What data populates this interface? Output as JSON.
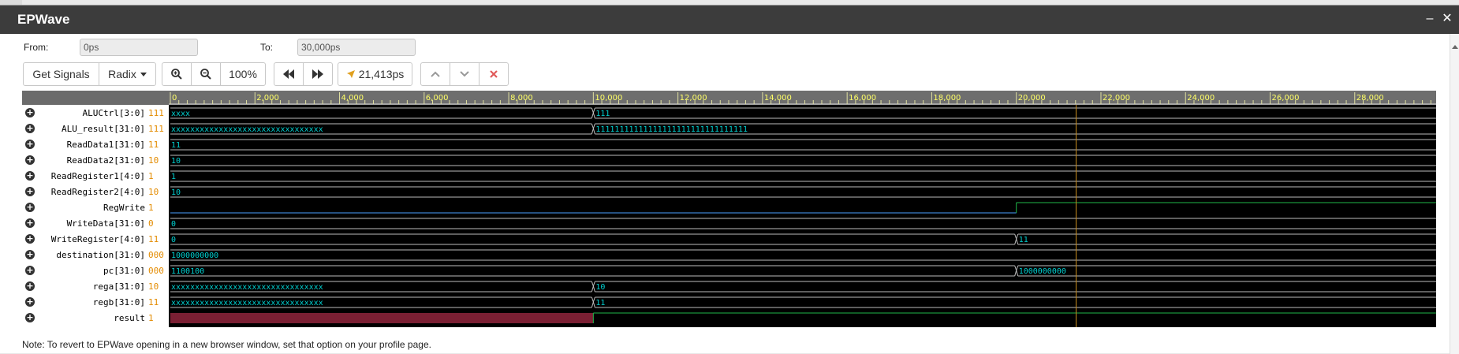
{
  "window": {
    "title": "EPWave",
    "minimize_glyph": "–",
    "close_glyph": "✕"
  },
  "range": {
    "from_label": "From:",
    "from_value": "0ps",
    "to_label": "To:",
    "to_value": "30,000ps"
  },
  "toolbar": {
    "get_signals": "Get Signals",
    "radix": "Radix",
    "zoom_in_icon": "zoom-in-icon",
    "zoom_out_icon": "zoom-out-icon",
    "zoom_level": "100%",
    "prev_edge_icon": "rewind-icon",
    "next_edge_icon": "fast-forward-icon",
    "cursor_time": "21,413ps",
    "cursor_icon": "cursor-arrow-icon",
    "up_icon": "chevron-up-icon",
    "down_icon": "chevron-down-icon",
    "delete_icon": "close-icon",
    "delete_color": "#e05a5a"
  },
  "timeline": {
    "start": 0,
    "end": 30000,
    "cursor": 21413,
    "tick_labels": [
      "0",
      "2,000",
      "4,000",
      "6,000",
      "8,000",
      "10,000",
      "12,000",
      "14,000",
      "16,000",
      "18,000",
      "20,000",
      "22,000",
      "24,000",
      "26,000",
      "28,000"
    ],
    "tick_values": [
      0,
      2000,
      4000,
      6000,
      8000,
      10000,
      12000,
      14000,
      16000,
      18000,
      20000,
      22000,
      24000,
      26000,
      28000
    ]
  },
  "colors": {
    "bus": "#00d0d0",
    "bit_high": "#1fb84a",
    "bit_low": "#4aa0ff",
    "cursor": "#c58a1c",
    "red_fill": "#7a1f33",
    "ruler_text": "#ffff66"
  },
  "signals": [
    {
      "name": "ALUCtrl[3:0]",
      "value": "111",
      "type": "bus",
      "segments": [
        {
          "start": 0,
          "label": "xxxx"
        },
        {
          "start": 10000,
          "label": "111"
        }
      ]
    },
    {
      "name": "ALU_result[31:0]",
      "value": "111",
      "type": "bus",
      "segments": [
        {
          "start": 0,
          "label": "xxxxxxxxxxxxxxxxxxxxxxxxxxxxxxxx"
        },
        {
          "start": 10000,
          "label": "11111111111111111111111111111111"
        }
      ]
    },
    {
      "name": "ReadData1[31:0]",
      "value": "11",
      "type": "bus",
      "segments": [
        {
          "start": 0,
          "label": "11"
        }
      ]
    },
    {
      "name": "ReadData2[31:0]",
      "value": "10",
      "type": "bus",
      "segments": [
        {
          "start": 0,
          "label": "10"
        }
      ]
    },
    {
      "name": "ReadRegister1[4:0]",
      "value": "1",
      "type": "bus",
      "segments": [
        {
          "start": 0,
          "label": "1"
        }
      ]
    },
    {
      "name": "ReadRegister2[4:0]",
      "value": "10",
      "type": "bus",
      "segments": [
        {
          "start": 0,
          "label": "10"
        }
      ]
    },
    {
      "name": "RegWrite",
      "value": "1",
      "type": "bit",
      "transitions": [
        {
          "start": 0,
          "level": 0
        },
        {
          "start": 20000,
          "level": 1
        }
      ]
    },
    {
      "name": "WriteData[31:0]",
      "value": "0",
      "type": "bus",
      "segments": [
        {
          "start": 0,
          "label": "0"
        }
      ]
    },
    {
      "name": "WriteRegister[4:0]",
      "value": "11",
      "type": "bus",
      "segments": [
        {
          "start": 0,
          "label": "0"
        },
        {
          "start": 20000,
          "label": "11"
        }
      ]
    },
    {
      "name": "destination[31:0]",
      "value": "000",
      "type": "bus",
      "segments": [
        {
          "start": 0,
          "label": "1000000000"
        }
      ]
    },
    {
      "name": "pc[31:0]",
      "value": "000",
      "type": "bus",
      "segments": [
        {
          "start": 0,
          "label": "1100100"
        },
        {
          "start": 20000,
          "label": "1000000000"
        }
      ]
    },
    {
      "name": "rega[31:0]",
      "value": "10",
      "type": "bus",
      "segments": [
        {
          "start": 0,
          "label": "xxxxxxxxxxxxxxxxxxxxxxxxxxxxxxxx"
        },
        {
          "start": 10000,
          "label": "10"
        }
      ]
    },
    {
      "name": "regb[31:0]",
      "value": "11",
      "type": "bus",
      "segments": [
        {
          "start": 0,
          "label": "xxxxxxxxxxxxxxxxxxxxxxxxxxxxxxxx"
        },
        {
          "start": 10000,
          "label": "11"
        }
      ]
    },
    {
      "name": "result",
      "value": "1",
      "type": "bit",
      "transitions": [
        {
          "start": 0,
          "level": "x"
        },
        {
          "start": 10000,
          "level": 1
        }
      ]
    }
  ],
  "footer": {
    "note": "Note: To revert to EPWave opening in a new browser window, set that option on your profile page."
  }
}
